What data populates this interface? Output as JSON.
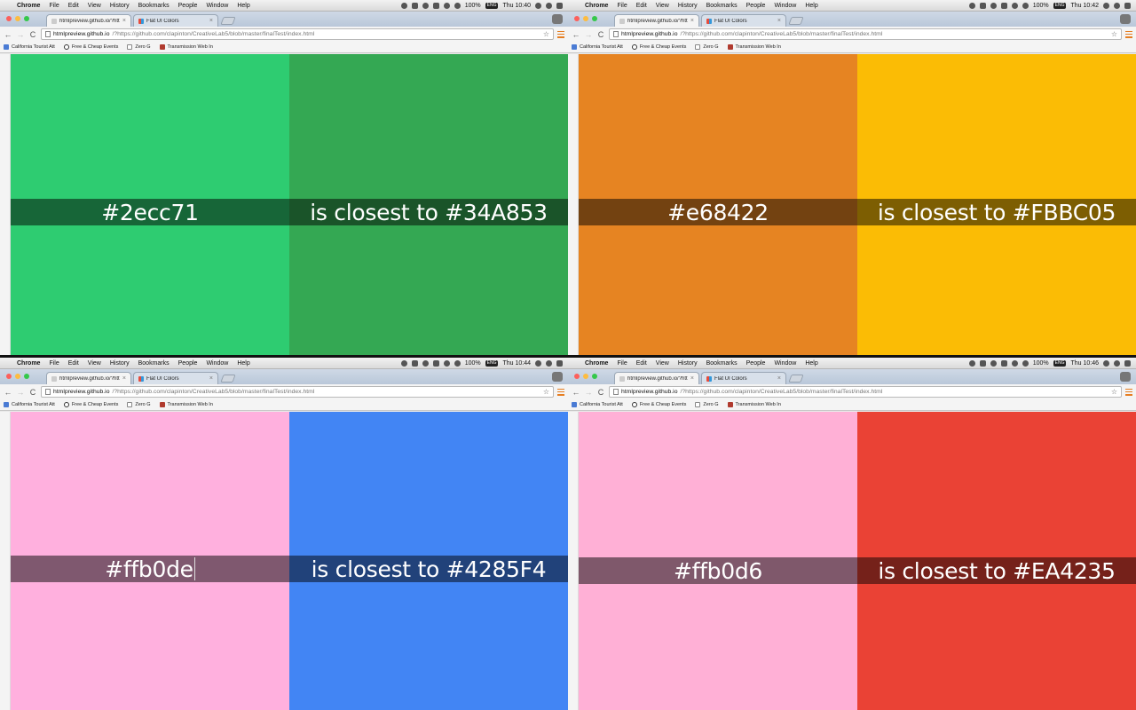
{
  "menubar": {
    "apple_glyph": "",
    "app_name": "Chrome",
    "items": [
      "File",
      "Edit",
      "View",
      "History",
      "Bookmarks",
      "People",
      "Window",
      "Help"
    ],
    "battery_text": "100%",
    "battery_badge": "ENG"
  },
  "browser": {
    "tabs": [
      {
        "title": "htmlpreview.github.io/?http",
        "close": "×"
      },
      {
        "title": "Flat UI Colors",
        "close": "×"
      }
    ],
    "url_host": "htmlpreview.github.io",
    "url_rest": "/?https://github.com/clapinton/CreativeLab5/blob/master/finalTest/index.html",
    "nav": {
      "back": "←",
      "forward": "→",
      "reload": "C",
      "star": "☆"
    },
    "bookmarks": [
      "California Tourist Att",
      "Free & Cheap Events",
      "Zero G",
      "Transmission Web In"
    ]
  },
  "screens": [
    {
      "time": "Thu 10:40",
      "input_color": "#2ecc71",
      "result_text": "is closest to #34A853",
      "left_bg": "#2ecc71",
      "right_bg": "#34A853",
      "left_band": "rgba(0,0,0,0.5)",
      "right_band": "rgba(0,0,0,0.5)"
    },
    {
      "time": "Thu 10:42",
      "input_color": "#e68422",
      "result_text": "is closest to #FBBC05",
      "left_bg": "#e68422",
      "right_bg": "#FBBC05",
      "left_band": "rgba(0,0,0,0.5)",
      "right_band": "rgba(0,0,0,0.5)"
    },
    {
      "time": "Thu 10:44",
      "input_color": "#ffb0de",
      "result_text": "is closest to #4285F4",
      "left_bg": "#ffb0de",
      "right_bg": "#4285F4",
      "left_band": "rgba(0,0,0,0.5)",
      "right_band": "rgba(0,0,0,0.5)"
    },
    {
      "time": "Thu 10:46",
      "input_color": "#ffb0d6",
      "result_text": "is closest to #EA4235",
      "left_bg": "#ffb0d6",
      "right_bg": "#EA4235",
      "left_band": "rgba(0,0,0,0.5)",
      "right_band": "rgba(0,0,0,0.5)"
    }
  ]
}
